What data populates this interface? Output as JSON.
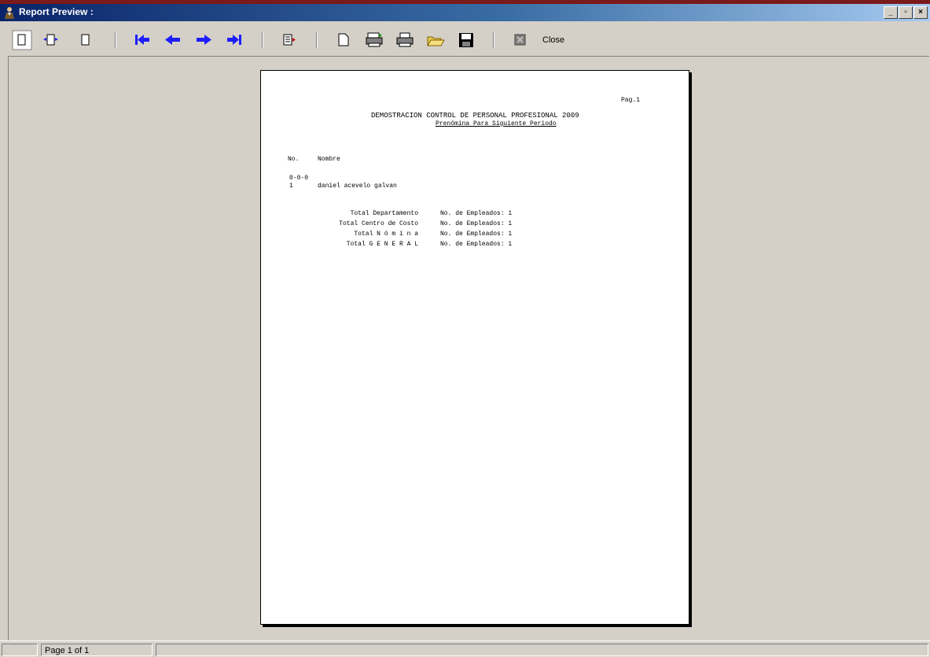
{
  "window": {
    "title": "Report Preview :"
  },
  "toolbar": {
    "close_label": "Close"
  },
  "report": {
    "page_label": "Pag.1",
    "title": "DEMOSTRACION CONTROL DE PERSONAL PROFESIONAL 2009",
    "subtitle": "Prenómina Para Siguiente Periodo",
    "col_no": "No.",
    "col_name": "Nombre",
    "group_code": "0-0-0",
    "row_no": "1",
    "row_name": "daniel acevelo galvan",
    "totals": [
      {
        "label": "Total Departamento",
        "count_label": "No. de Empleados: 1"
      },
      {
        "label": "Total Centro de Costo",
        "count_label": "No. de Empleados: 1"
      },
      {
        "label": "Total N ó m i n a",
        "count_label": "No. de Empleados: 1"
      },
      {
        "label": "Total G E N E R A L",
        "count_label": "No. de Empleados: 1"
      }
    ]
  },
  "status": {
    "page_indicator": "Page 1 of 1"
  }
}
